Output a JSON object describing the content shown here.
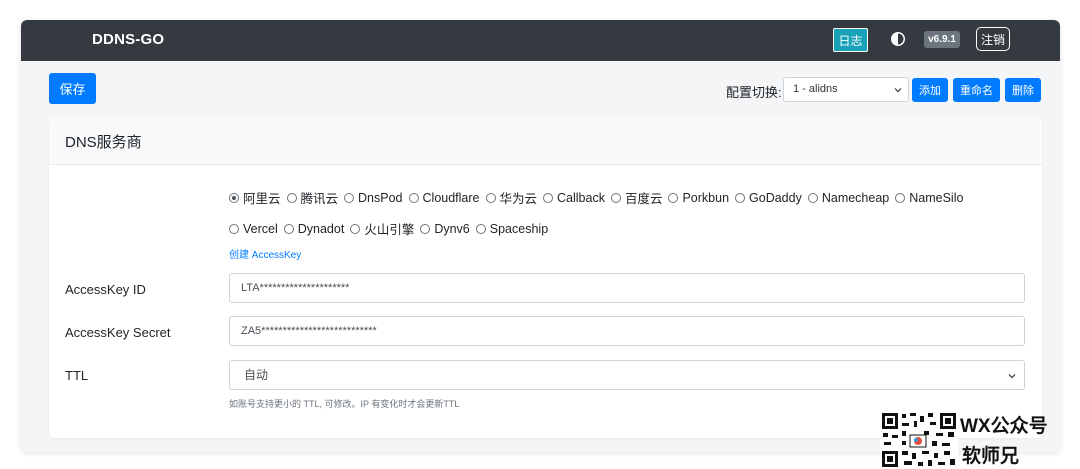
{
  "navbar": {
    "brand": "DDNS-GO",
    "log_button": "日志",
    "theme_icon": "theme-toggle-icon",
    "version": "v6.9.1",
    "logout_button": "注销"
  },
  "toolbar": {
    "save_label": "保存",
    "config_label": "配置切换:",
    "config_selected": "1 - alidns",
    "add_label": "添加",
    "rename_label": "重命名",
    "delete_label": "删除"
  },
  "dns_card": {
    "title": "DNS服务商",
    "providers_row1": [
      "阿里云",
      "腾讯云",
      "DnsPod",
      "Cloudflare",
      "华为云",
      "Callback",
      "百度云",
      "Porkbun",
      "GoDaddy",
      "Namecheap",
      "NameSilo"
    ],
    "providers_row2": [
      "Vercel",
      "Dynadot",
      "火山引擎",
      "Dynv6",
      "Spaceship"
    ],
    "selected_provider": "阿里云",
    "create_link": "创建 AccessKey",
    "accesskey_id_label": "AccessKey ID",
    "accesskey_id_value": "LTA*********************",
    "accesskey_secret_label": "AccessKey Secret",
    "accesskey_secret_value": "ZA5***************************",
    "ttl_label": "TTL",
    "ttl_value": "自动",
    "ttl_help": "如账号支持更小的 TTL, 可修改。IP 有变化时才会更新TTL"
  },
  "watermark": {
    "line1": "WX公众号",
    "line2": "软师兄"
  },
  "colors": {
    "navbar_bg": "#343a40",
    "primary": "#007bff",
    "info": "#17a2b8",
    "secondary": "#6c757d"
  }
}
